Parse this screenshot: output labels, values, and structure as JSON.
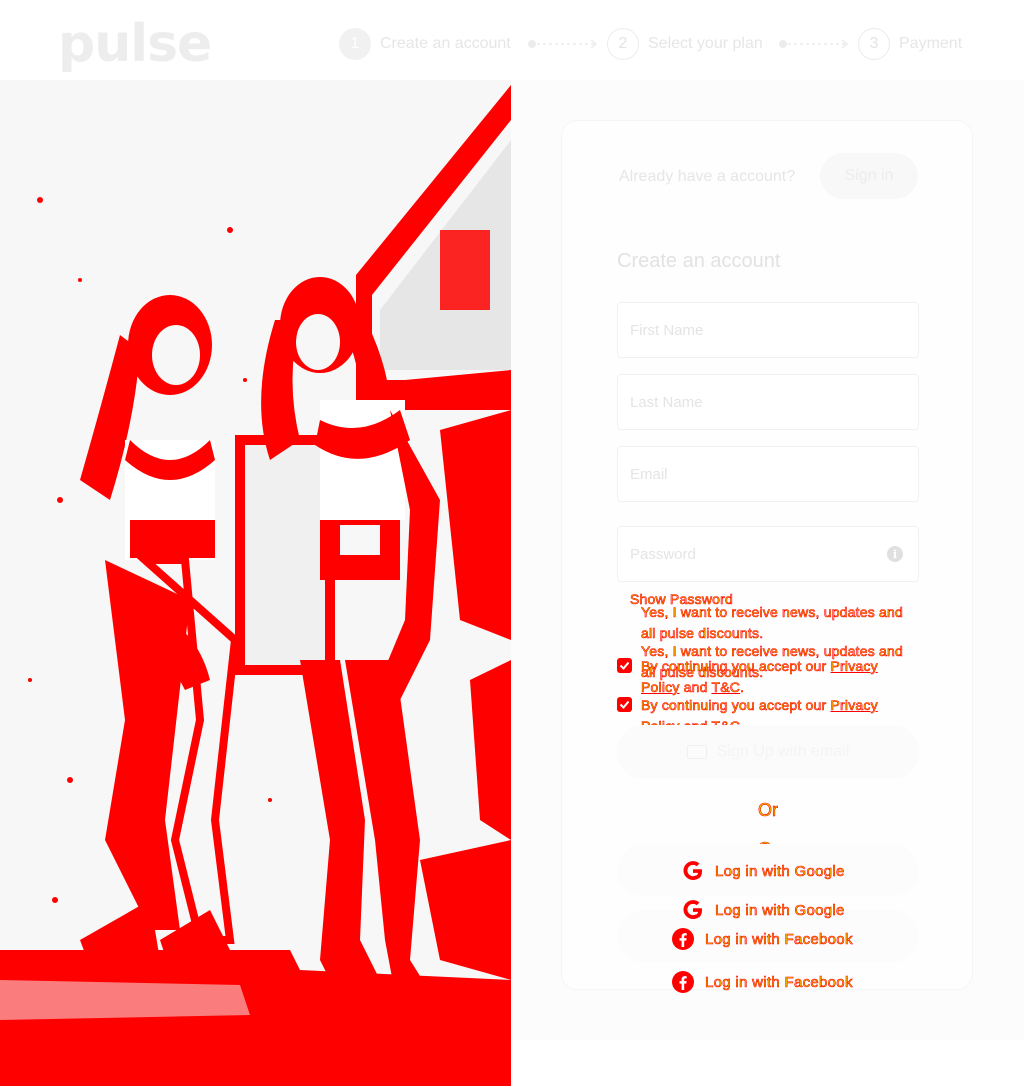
{
  "brand": {
    "logo": "pulse"
  },
  "steps": [
    {
      "number": "1",
      "label": "Create an account"
    },
    {
      "number": "2",
      "label": "Select your plan"
    },
    {
      "number": "3",
      "label": "Payment"
    }
  ],
  "signin": {
    "prompt": "Already have a account?",
    "button": "Sign in"
  },
  "form": {
    "title": "Create an account",
    "first_name_placeholder": "First Name",
    "last_name_placeholder": "Last Name",
    "email_placeholder": "Email",
    "password_placeholder": "Password",
    "show_password": "Show Password",
    "newsletter": "Yes, I want to receive news, updates and all pulse discounts.",
    "terms_prefix": "By continuing you accept our",
    "privacy_link": "Privacy Policy",
    "and": "and",
    "tc_link": "T&C",
    "period": ".",
    "submit": "Sign Up with email"
  },
  "social": {
    "or": "Or",
    "google": "Log in with Google",
    "facebook": "Log in with Facebook"
  },
  "colors": {
    "overlay_text": "#e8d400",
    "overlay_accent": "#ff0000",
    "google_icon": "#ff0000",
    "facebook_icon": "#ff0000"
  },
  "icons": [
    "info-icon",
    "checkbox-checked-icon",
    "mail-icon",
    "google-icon",
    "facebook-icon"
  ]
}
